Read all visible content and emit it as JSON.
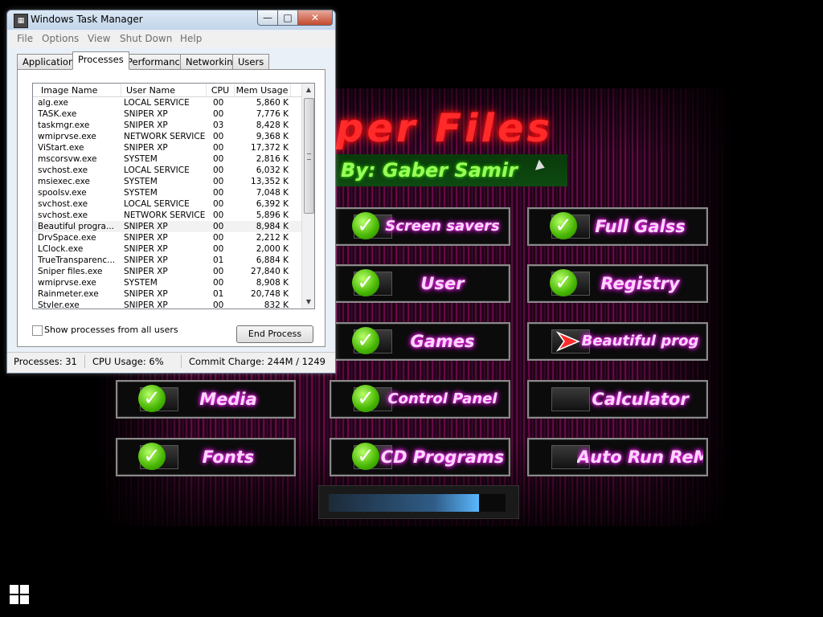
{
  "app": {
    "title": "per  Files",
    "author": "By: Gaber  Samir",
    "progress_fraction": 0.85,
    "buttons": [
      {
        "label": "Screen savers",
        "icon": "check-icon",
        "col": 1,
        "row": 0
      },
      {
        "label": "User",
        "icon": "check-icon",
        "col": 1,
        "row": 1
      },
      {
        "label": "Games",
        "icon": "check-icon",
        "col": 1,
        "row": 2
      },
      {
        "label": "Control Panel",
        "icon": "check-icon",
        "col": 1,
        "row": 3
      },
      {
        "label": "CD Programs",
        "icon": "check-icon",
        "col": 1,
        "row": 4
      },
      {
        "label": "Full Galss",
        "icon": "check-icon",
        "col": 2,
        "row": 0
      },
      {
        "label": "Registry",
        "icon": "check-icon",
        "col": 2,
        "row": 1
      },
      {
        "label": "Beautiful prog",
        "icon": "arrow-icon",
        "col": 2,
        "row": 2
      },
      {
        "label": "Calculator",
        "icon": "none",
        "col": 2,
        "row": 3
      },
      {
        "label": "Auto Run ReM",
        "icon": "none",
        "col": 2,
        "row": 4
      },
      {
        "label": "Media",
        "icon": "check-icon",
        "col": 0,
        "row": 3
      },
      {
        "label": "Fonts",
        "icon": "check-icon",
        "col": 0,
        "row": 4
      }
    ]
  },
  "taskmgr": {
    "title": "Windows Task Manager",
    "menu": [
      "File",
      "Options",
      "View",
      "Shut Down",
      "Help"
    ],
    "tabs": [
      "Applications",
      "Processes",
      "Performance",
      "Networking",
      "Users"
    ],
    "active_tab": "Processes",
    "columns": [
      "Image Name",
      "User Name",
      "CPU",
      "Mem Usage"
    ],
    "rows": [
      [
        "alg.exe",
        "LOCAL SERVICE",
        "00",
        "5,860 K"
      ],
      [
        "TASK.exe",
        "SNIPER XP",
        "00",
        "7,776 K"
      ],
      [
        "taskmgr.exe",
        "SNIPER XP",
        "03",
        "8,428 K"
      ],
      [
        "wmiprvse.exe",
        "NETWORK SERVICE",
        "00",
        "9,368 K"
      ],
      [
        "ViStart.exe",
        "SNIPER XP",
        "00",
        "17,372 K"
      ],
      [
        "mscorsvw.exe",
        "SYSTEM",
        "00",
        "2,816 K"
      ],
      [
        "svchost.exe",
        "LOCAL SERVICE",
        "00",
        "6,032 K"
      ],
      [
        "msiexec.exe",
        "SYSTEM",
        "00",
        "13,352 K"
      ],
      [
        "spoolsv.exe",
        "SYSTEM",
        "00",
        "7,048 K"
      ],
      [
        "svchost.exe",
        "LOCAL SERVICE",
        "00",
        "6,392 K"
      ],
      [
        "svchost.exe",
        "NETWORK SERVICE",
        "00",
        "5,896 K"
      ],
      [
        "Beautiful progra...",
        "SNIPER XP",
        "00",
        "8,984 K"
      ],
      [
        "DrvSpace.exe",
        "SNIPER XP",
        "00",
        "2,212 K"
      ],
      [
        "LClock.exe",
        "SNIPER XP",
        "00",
        "2,000 K"
      ],
      [
        "TrueTransparenc...",
        "SNIPER XP",
        "01",
        "6,884 K"
      ],
      [
        "Sniper files.exe",
        "SNIPER XP",
        "00",
        "27,840 K"
      ],
      [
        "wmiprvse.exe",
        "SYSTEM",
        "00",
        "8,908 K"
      ],
      [
        "Rainmeter.exe",
        "SNIPER XP",
        "01",
        "20,748 K"
      ],
      [
        "Stvler.exe",
        "SNIPER XP",
        "00",
        "832 K"
      ]
    ],
    "selected_row": 11,
    "show_all_label": "Show processes from all users",
    "end_process_label": "End Process",
    "status": {
      "processes": "Processes: 31",
      "cpu": "CPU Usage: 6%",
      "commit": "Commit Charge: 244M / 1249"
    },
    "window_buttons": {
      "minimize": "—",
      "maximize": "□",
      "close": "✕"
    }
  }
}
